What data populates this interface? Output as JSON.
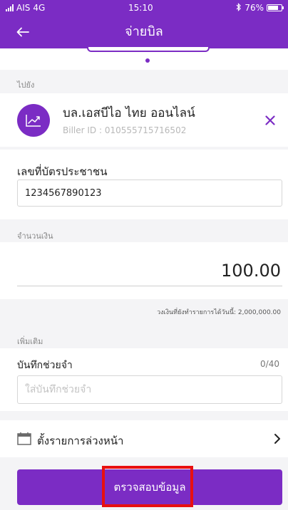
{
  "status_bar": {
    "carrier": "AIS",
    "network": "4G",
    "time": "15:10",
    "battery": "76%",
    "battery_level": 0.76,
    "bluetooth_icon": "bluetooth-icon"
  },
  "nav": {
    "title": "จ่ายบิล",
    "back_icon": "back-arrow-icon"
  },
  "carousel": {
    "page_dot_count": 1
  },
  "destination": {
    "section_label": "ไปยัง",
    "biller_name": "บล.เอสบีไอ ไทย ออนไลน์",
    "biller_id": "Biller ID : 010555715716502",
    "biller_icon": "chart-up-icon",
    "remove_icon": "close-icon"
  },
  "reference": {
    "label": "เลขที่บัตรประชาชน",
    "value": "1234567890123"
  },
  "amount": {
    "section_label": "จำนวนเงิน",
    "value": "100.00",
    "limit_text": "วงเงินที่ยังทำรายการได้วันนี้: 2,000,000.00"
  },
  "extra": {
    "section_label": "เพิ่มเติม",
    "memo_label": "บันทึกช่วยจำ",
    "memo_counter": "0/40",
    "memo_placeholder": "ใส่บันทึกช่วยจำ",
    "memo_value": ""
  },
  "schedule": {
    "label": "ตั้งรายการล่วงหน้า",
    "icon": "calendar-icon",
    "chevron": "chevron-right-icon"
  },
  "submit": {
    "label": "ตรวจสอบข้อมูล"
  },
  "colors": {
    "brand_purple": "#7b2cc4",
    "highlight_red": "#e81010",
    "background": "#f4f4f6"
  }
}
